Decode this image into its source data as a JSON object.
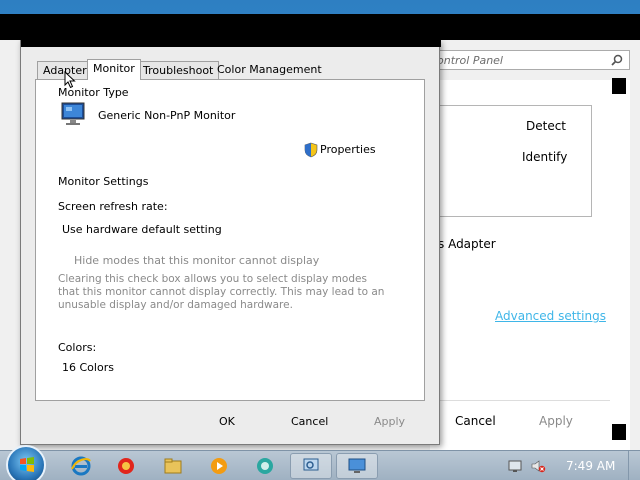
{
  "back_window": {
    "address_text": "ontrol Panel",
    "buttons": {
      "detect": "Detect",
      "identify": "Identify",
      "cancel": "Cancel",
      "apply": "Apply"
    },
    "adapter_label": "s Adapter",
    "advanced_link": "Advanced settings"
  },
  "dialog": {
    "tabs": [
      {
        "label": "Adapter"
      },
      {
        "label": "Monitor"
      },
      {
        "label": "Troubleshoot"
      },
      {
        "label": "Color Management"
      }
    ],
    "monitor_type_heading": "Monitor Type",
    "monitor_name": "Generic Non-PnP Monitor",
    "properties_label": "Properties",
    "monitor_settings_heading": "Monitor Settings",
    "refresh_rate_label": "Screen refresh rate:",
    "refresh_rate_value": "Use hardware default setting",
    "hide_modes_label": "Hide modes that this monitor cannot display",
    "hide_modes_description": "Clearing this check box allows you to select display modes that this monitor cannot display correctly. This may lead to an unusable display and/or damaged hardware.",
    "colors_label": "Colors:",
    "colors_value": "16 Colors",
    "buttons": {
      "ok": "OK",
      "cancel": "Cancel",
      "apply": "Apply"
    }
  },
  "taskbar": {
    "clock": "7:49 AM",
    "pinned": [
      "internet-explorer-icon",
      "media-icon",
      "explorer-icon",
      "media-player-icon",
      "network-icon",
      "magnifier-icon",
      "display-icon"
    ]
  }
}
